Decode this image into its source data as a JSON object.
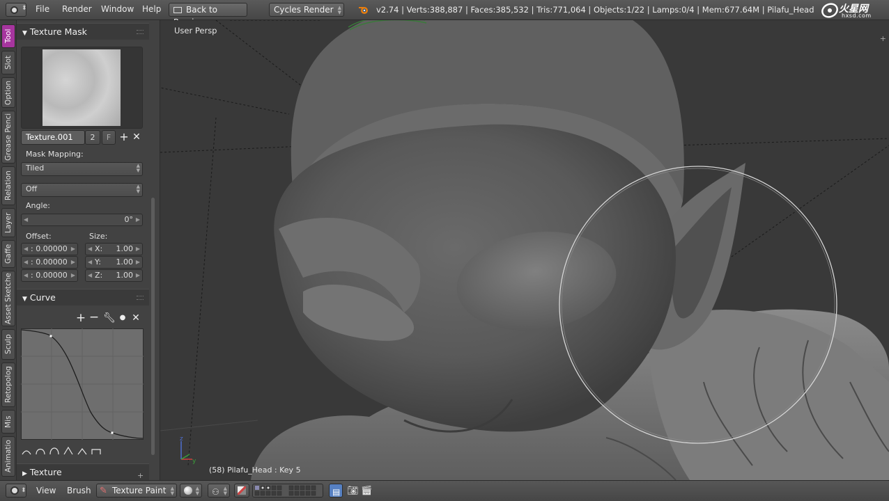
{
  "topbar": {
    "menu_file": "File",
    "menu_render": "Render",
    "menu_window": "Window",
    "menu_help": "Help",
    "back_label": "Back to Previous",
    "engine": "Cycles Render",
    "stats": "v2.74 | Verts:388,887 | Faces:385,532 | Tris:771,064 | Objects:1/22 | Lamps:0/4 | Mem:677.64M | Pilafu_Head",
    "watermark_text": "火星网",
    "watermark_url": "hxsd.com"
  },
  "tabs": [
    "Tool",
    "Slot",
    "Option",
    "Grease Penci",
    "Relation",
    "Layer",
    "Gaffe",
    "Asset Sketche",
    "Sculp",
    "Retopolog",
    "Mis",
    "Animatio"
  ],
  "active_tab": "Tool",
  "accent_color": "#a6359e",
  "panel": {
    "texture_mask_title": "Texture Mask",
    "texture_name": "Texture.001",
    "texture_users": "2",
    "fake_user": "F",
    "mask_mapping_label": "Mask Mapping:",
    "mapping_value": "Tiled",
    "random_value": "Off",
    "angle_label": "Angle:",
    "angle_value": "0°",
    "offset_label": "Offset:",
    "size_label": "Size:",
    "offset": [
      ": 0.00000",
      ": 0.00000",
      ": 0.00000"
    ],
    "size": [
      {
        "axis": "X:",
        "value": "1.00"
      },
      {
        "axis": "Y:",
        "value": "1.00"
      },
      {
        "axis": "Z:",
        "value": "1.00"
      }
    ],
    "curve_title": "Curve",
    "texture_title": "Texture"
  },
  "viewport": {
    "title": "User Persp",
    "status": "(58) Pilafu_Head : Key 5"
  },
  "bottombar": {
    "view": "View",
    "brush": "Brush",
    "mode": "Texture Paint"
  }
}
